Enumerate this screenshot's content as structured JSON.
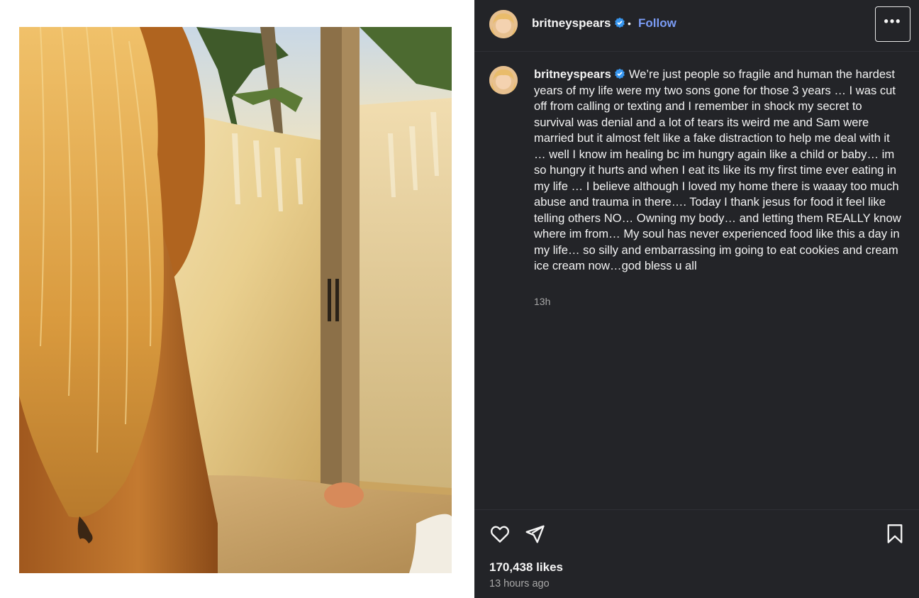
{
  "post": {
    "username": "britneyspears",
    "follow_label": "Follow",
    "separator": "•",
    "more_label": "•••",
    "caption": "We’re just people so fragile and human the hardest years of my life were my two sons gone for those 3 years … I was cut off from calling or texting and I remember in shock my secret to survival was denial and a lot of tears its weird me and Sam were married but it almost felt like a fake distraction to help me deal with it … well I know im healing bc im hungry again like a child or baby… im so hungry it hurts and when I eat its like its my first time ever eating in my life … I believe although I loved my home there is waaay too much abuse and trauma in there…. Today I thank jesus for food it feel like telling others NO… Owning my body… and letting them REALLY know where im from… My soul has never experienced food like this a day in my life… so silly and embarrassing im going to eat cookies and cream ice cream now…god bless u all",
    "caption_time": "13h",
    "likes": "170,438 likes",
    "time_ago": "13 hours ago"
  },
  "icons": {
    "verified": "verified-badge-icon",
    "like": "heart-icon",
    "share": "paper-plane-icon",
    "save": "bookmark-icon"
  },
  "colors": {
    "panel_bg": "#232428",
    "follow_blue": "#7b9cf5",
    "verified_blue": "#3897f0"
  }
}
